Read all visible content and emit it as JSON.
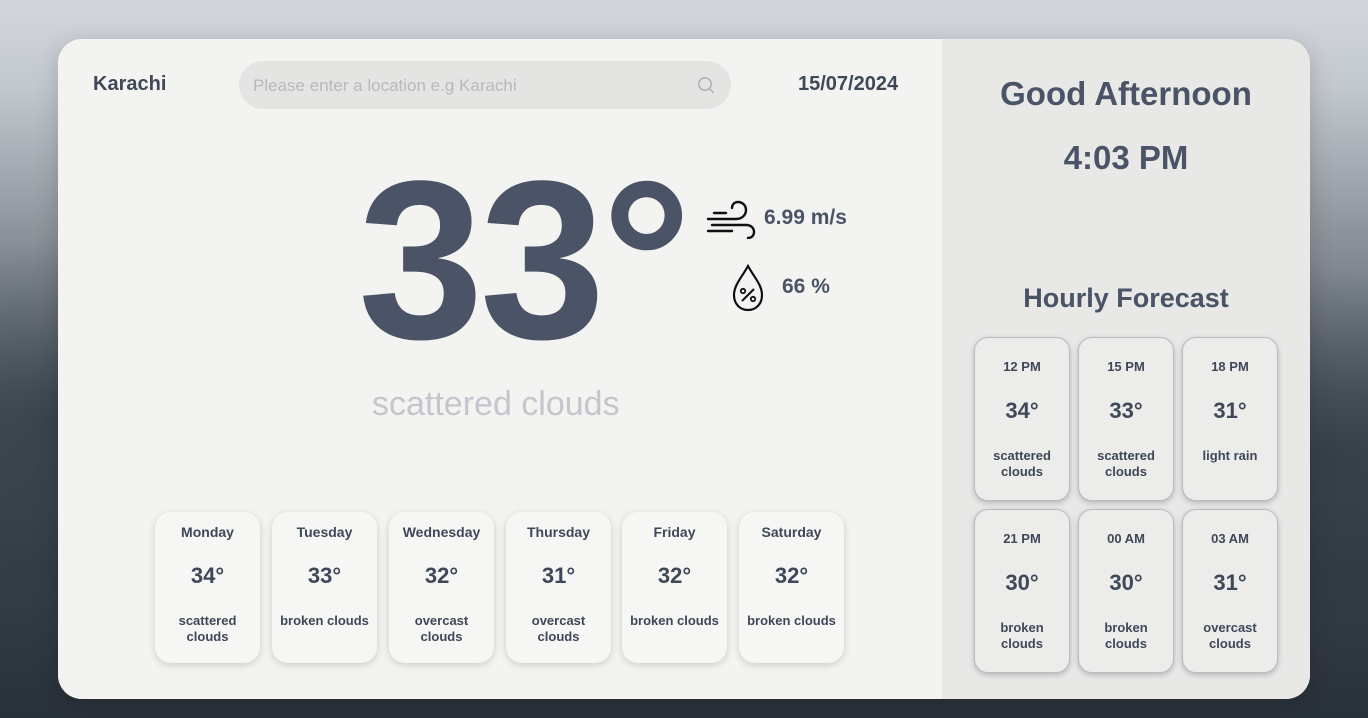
{
  "location": {
    "city": "Karachi",
    "date": "15/07/2024"
  },
  "search": {
    "placeholder": "Please enter a location e.g Karachi",
    "value": "",
    "icon": "search-icon"
  },
  "current": {
    "temperature": "33°",
    "description": "scattered clouds",
    "wind": {
      "icon": "wind-icon",
      "value": "6.99 m/s"
    },
    "humidity": {
      "icon": "humidity-icon",
      "value": "66 %"
    }
  },
  "daily": [
    {
      "day": "Monday",
      "temp": "34°",
      "desc": "scattered clouds"
    },
    {
      "day": "Tuesday",
      "temp": "33°",
      "desc": "broken clouds"
    },
    {
      "day": "Wednesday",
      "temp": "32°",
      "desc": "overcast clouds"
    },
    {
      "day": "Thursday",
      "temp": "31°",
      "desc": "overcast clouds"
    },
    {
      "day": "Friday",
      "temp": "32°",
      "desc": "broken clouds"
    },
    {
      "day": "Saturday",
      "temp": "32°",
      "desc": "broken clouds"
    }
  ],
  "panel": {
    "greeting": "Good Afternoon",
    "time": "4:03 PM",
    "hourly_title": "Hourly Forecast"
  },
  "hourly": [
    {
      "time": "12 PM",
      "temp": "34°",
      "desc": "scattered clouds"
    },
    {
      "time": "15 PM",
      "temp": "33°",
      "desc": "scattered clouds"
    },
    {
      "time": "18 PM",
      "temp": "31°",
      "desc": "light rain"
    },
    {
      "time": "21 PM",
      "temp": "30°",
      "desc": "broken clouds"
    },
    {
      "time": "00 AM",
      "temp": "30°",
      "desc": "broken clouds"
    },
    {
      "time": "03 AM",
      "temp": "31°",
      "desc": "overcast clouds"
    }
  ],
  "colors": {
    "primary_text": "#4a5466",
    "muted_text": "#c3c6cd",
    "card_bg": "#f3f3f1",
    "panel_bg": "#e8e8e7"
  }
}
